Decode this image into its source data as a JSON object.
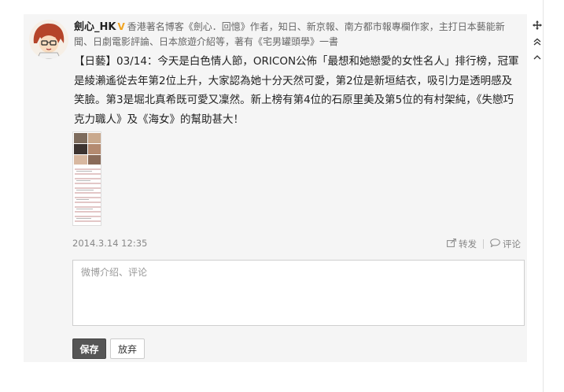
{
  "post": {
    "author": "劍心_HK",
    "verified_badge": "V",
    "bio": "香港著名博客《劍心．回憶》作者，知日、新京報、南方都市報專欄作家，主打日本藝能新聞、日劇電影評論、日本旅遊介紹等，著有《宅男罐頭學》一書",
    "text": "【日藝】03/14：今天是白色情人節，ORICON公佈「最想和她戀愛的女性名人」排行榜，冠軍是綾瀨遙從去年第2位上升，大家認為她十分天然可愛，第2位是新垣結衣，吸引力是透明感及笑臉。第3是堀北真希既可愛又凜然。新上榜有第4位的石原里美及第5位的有村架純，《失戀巧克力職人》及《海女》的幫助甚大！",
    "date": "2014.3.14 12:35",
    "repost_label": "转发",
    "comment_label": "评论"
  },
  "tools": {
    "move_icon": "move-icon",
    "collapse_icon": "double-chevron-up-icon",
    "up_icon": "chevron-up-icon"
  },
  "comment": {
    "placeholder": "微博介绍、评论"
  },
  "buttons": {
    "save_label": "保存",
    "cancel_label": "放弃"
  }
}
